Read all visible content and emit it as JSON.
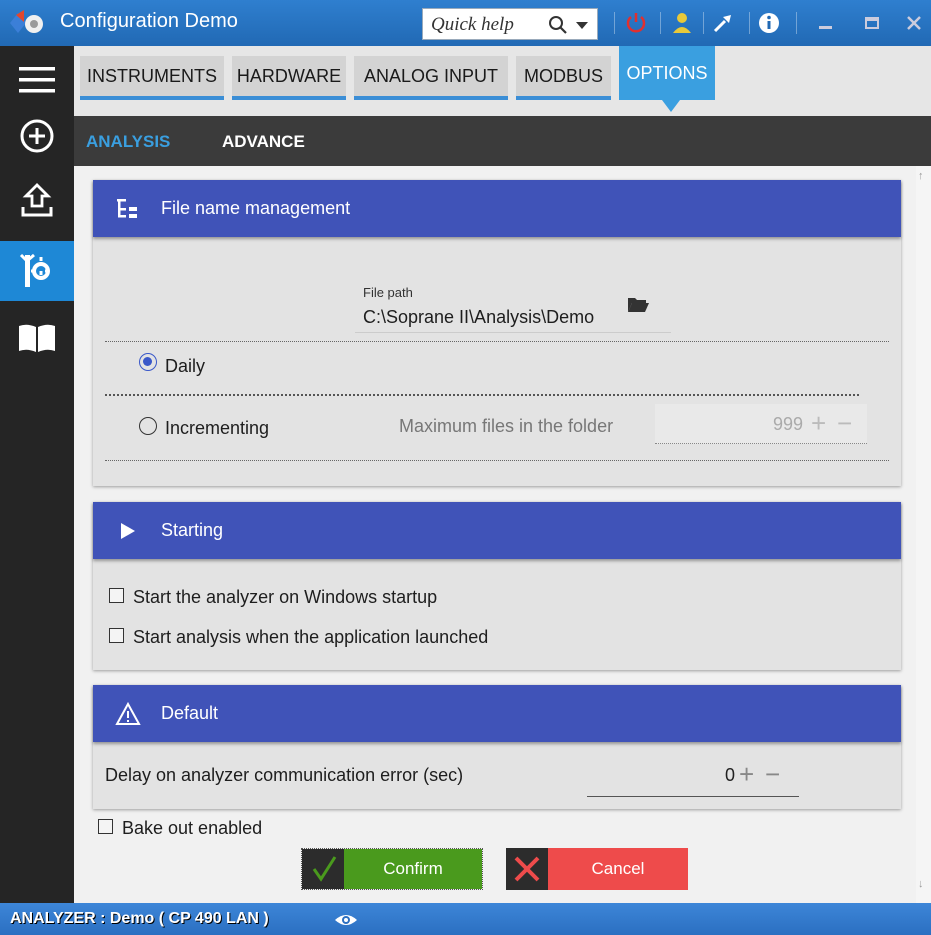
{
  "window": {
    "title": "Configuration Demo",
    "quick_help_placeholder": "Quick help"
  },
  "colors": {
    "accent": "#3a9fe0",
    "card_header": "#4053b8",
    "confirm": "#4a9a1d",
    "cancel": "#ee4b4b",
    "status_bar": "#2f7bd0"
  },
  "toolbar_icons": [
    "power-icon",
    "user-icon",
    "tools-icon",
    "info-icon",
    "minimize-icon",
    "maximize-icon",
    "close-icon"
  ],
  "sidebar": {
    "items": [
      "menu-icon",
      "add-icon",
      "upload-icon",
      "settings-tools-icon",
      "book-icon"
    ],
    "active_index": 3
  },
  "tabs": [
    {
      "label": "INSTRUMENTS"
    },
    {
      "label": "HARDWARE"
    },
    {
      "label": "ANALOG INPUT"
    },
    {
      "label": "MODBUS"
    },
    {
      "label": "OPTIONS",
      "active": true
    }
  ],
  "subtabs": [
    {
      "label": "ANALYSIS",
      "active": true
    },
    {
      "label": "ADVANCE"
    }
  ],
  "file_name_management": {
    "title": "File name management",
    "file_path_label": "File path",
    "file_path_value": "C:\\Soprane II\\Analysis\\Demo",
    "daily_label": "Daily",
    "daily_selected": true,
    "incrementing_label": "Incrementing",
    "max_files_label": "Maximum files in the folder",
    "max_files_value": "999"
  },
  "starting": {
    "title": "Starting",
    "option_windows_startup": "Start the analyzer on Windows startup",
    "option_app_launched": "Start analysis when the application launched"
  },
  "default": {
    "title": "Default",
    "delay_label": "Delay on analyzer communication error (sec)",
    "delay_value": "0"
  },
  "bake_out_label": "Bake out enabled",
  "buttons": {
    "confirm": "Confirm",
    "cancel": "Cancel"
  },
  "status": {
    "text": "ANALYZER :  Demo ( CP 490 LAN )"
  }
}
